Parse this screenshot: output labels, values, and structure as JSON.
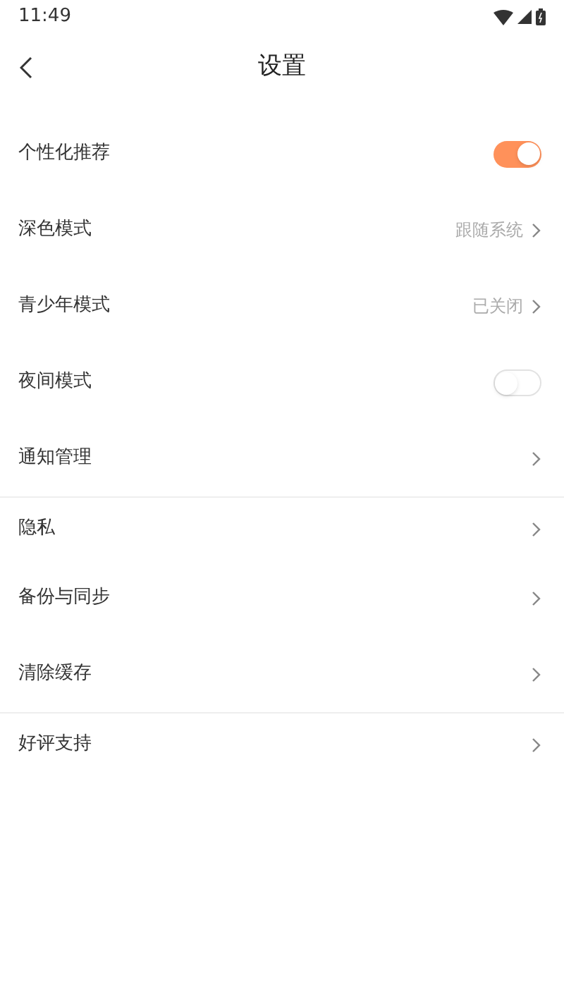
{
  "status_bar": {
    "time": "11:49"
  },
  "header": {
    "title": "设置"
  },
  "settings": [
    {
      "kind": "toggle",
      "label": "个性化推荐",
      "on": true,
      "divider_below": false
    },
    {
      "kind": "link",
      "label": "深色模式",
      "value": "跟随系统",
      "divider_below": false
    },
    {
      "kind": "link",
      "label": "青少年模式",
      "value": "已关闭",
      "divider_below": false
    },
    {
      "kind": "toggle",
      "label": "夜间模式",
      "on": false,
      "divider_below": false
    },
    {
      "kind": "link",
      "label": "通知管理",
      "divider_below": true
    },
    {
      "kind": "link",
      "label": "隐私",
      "divider_below": false
    },
    {
      "kind": "link",
      "label": "备份与同步",
      "divider_below": false
    },
    {
      "kind": "link",
      "label": "清除缓存",
      "divider_below": true
    },
    {
      "kind": "link",
      "label": "好评支持",
      "divider_below": false
    }
  ]
}
